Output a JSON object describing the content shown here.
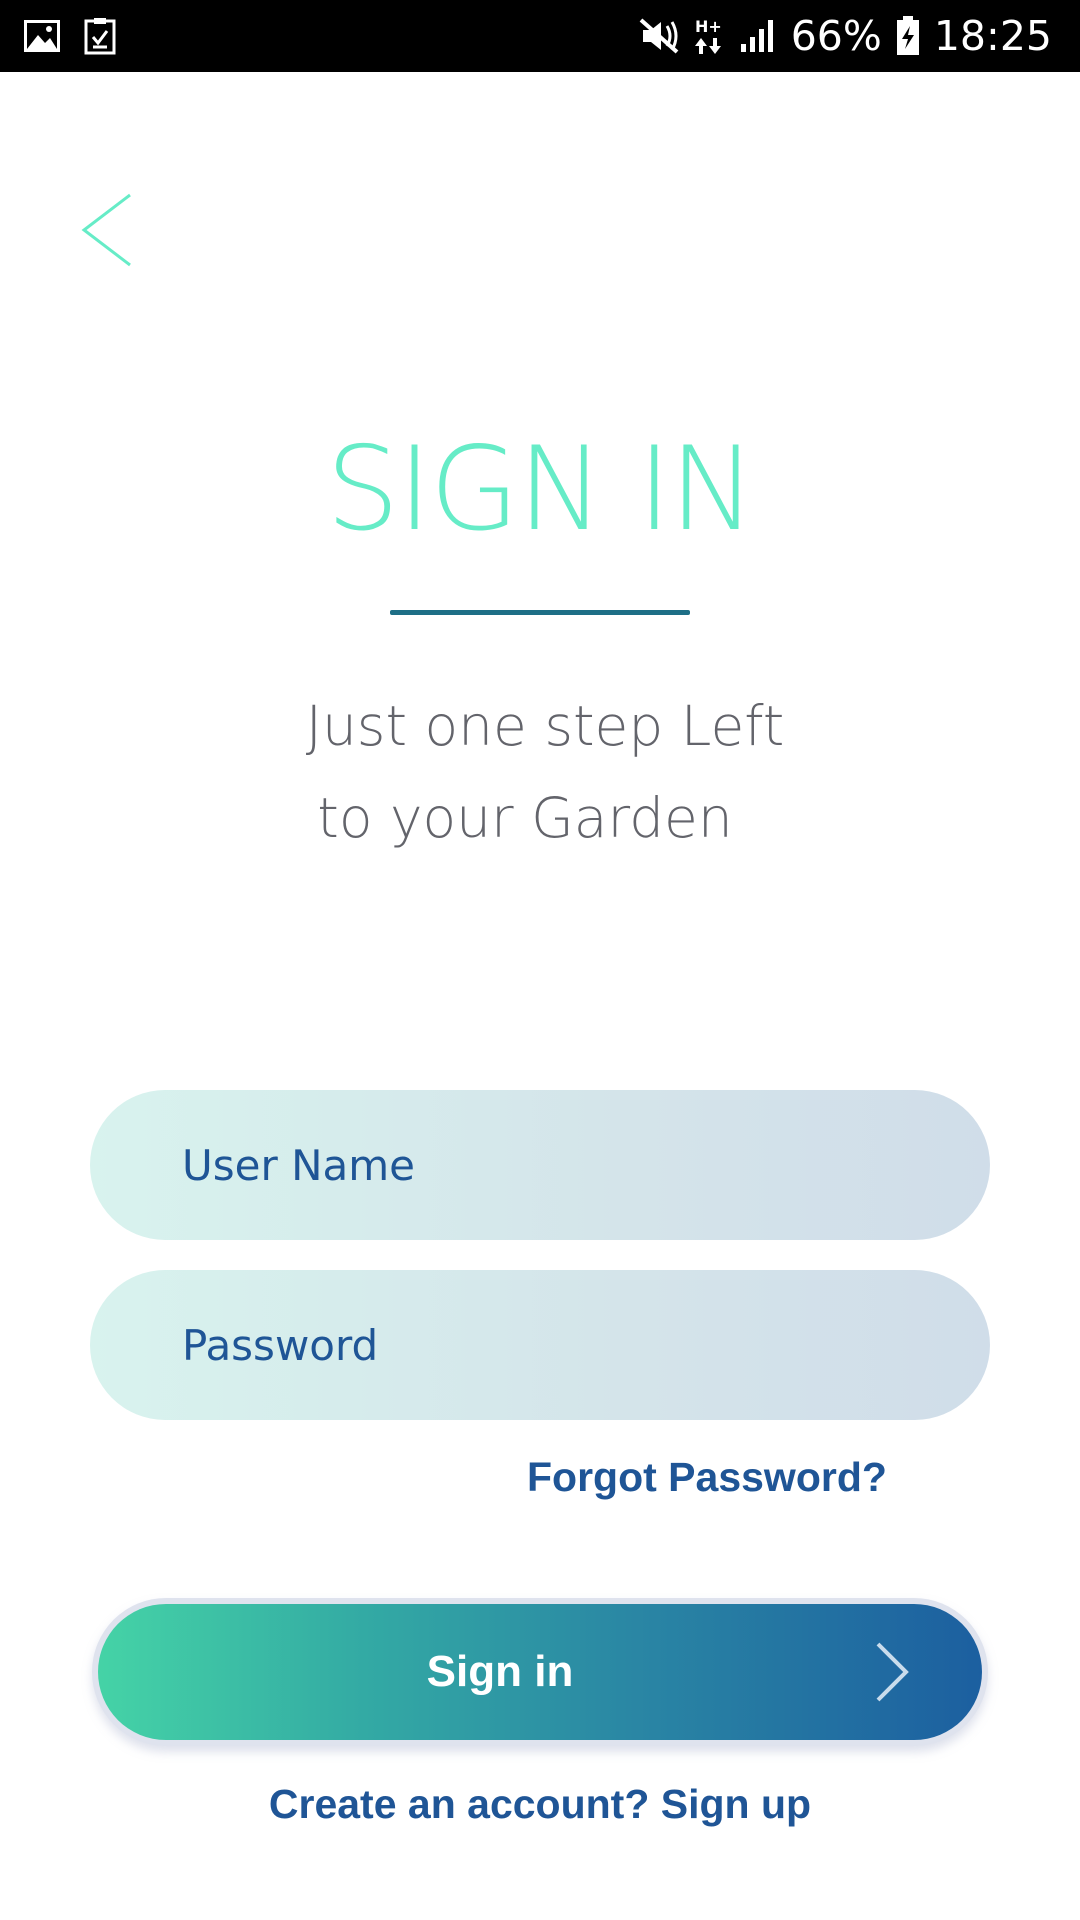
{
  "status_bar": {
    "icons_left": [
      "gallery-icon",
      "task-checkbox-icon"
    ],
    "icons_right": [
      "mute-vibrate-icon",
      "hplus-data-icon",
      "signal-icon",
      "battery-charging-icon"
    ],
    "battery": "66%",
    "time": "18:25"
  },
  "header": {
    "back_icon": "chevron-left-icon"
  },
  "hero": {
    "title": "SIGN IN",
    "subtitle_line1": "Just one step Left",
    "subtitle_line2": "to your Garden"
  },
  "form": {
    "username_placeholder": "User Name",
    "username_value": "",
    "password_placeholder": "Password",
    "password_value": "",
    "forgot_label": "Forgot Password?",
    "signin_label": "Sign in",
    "signup_label": "Create an account? Sign up"
  },
  "colors": {
    "title": "#66ecc7",
    "link": "#1f5596",
    "button_start": "#45d3a6",
    "button_end": "#1c5fa0"
  }
}
